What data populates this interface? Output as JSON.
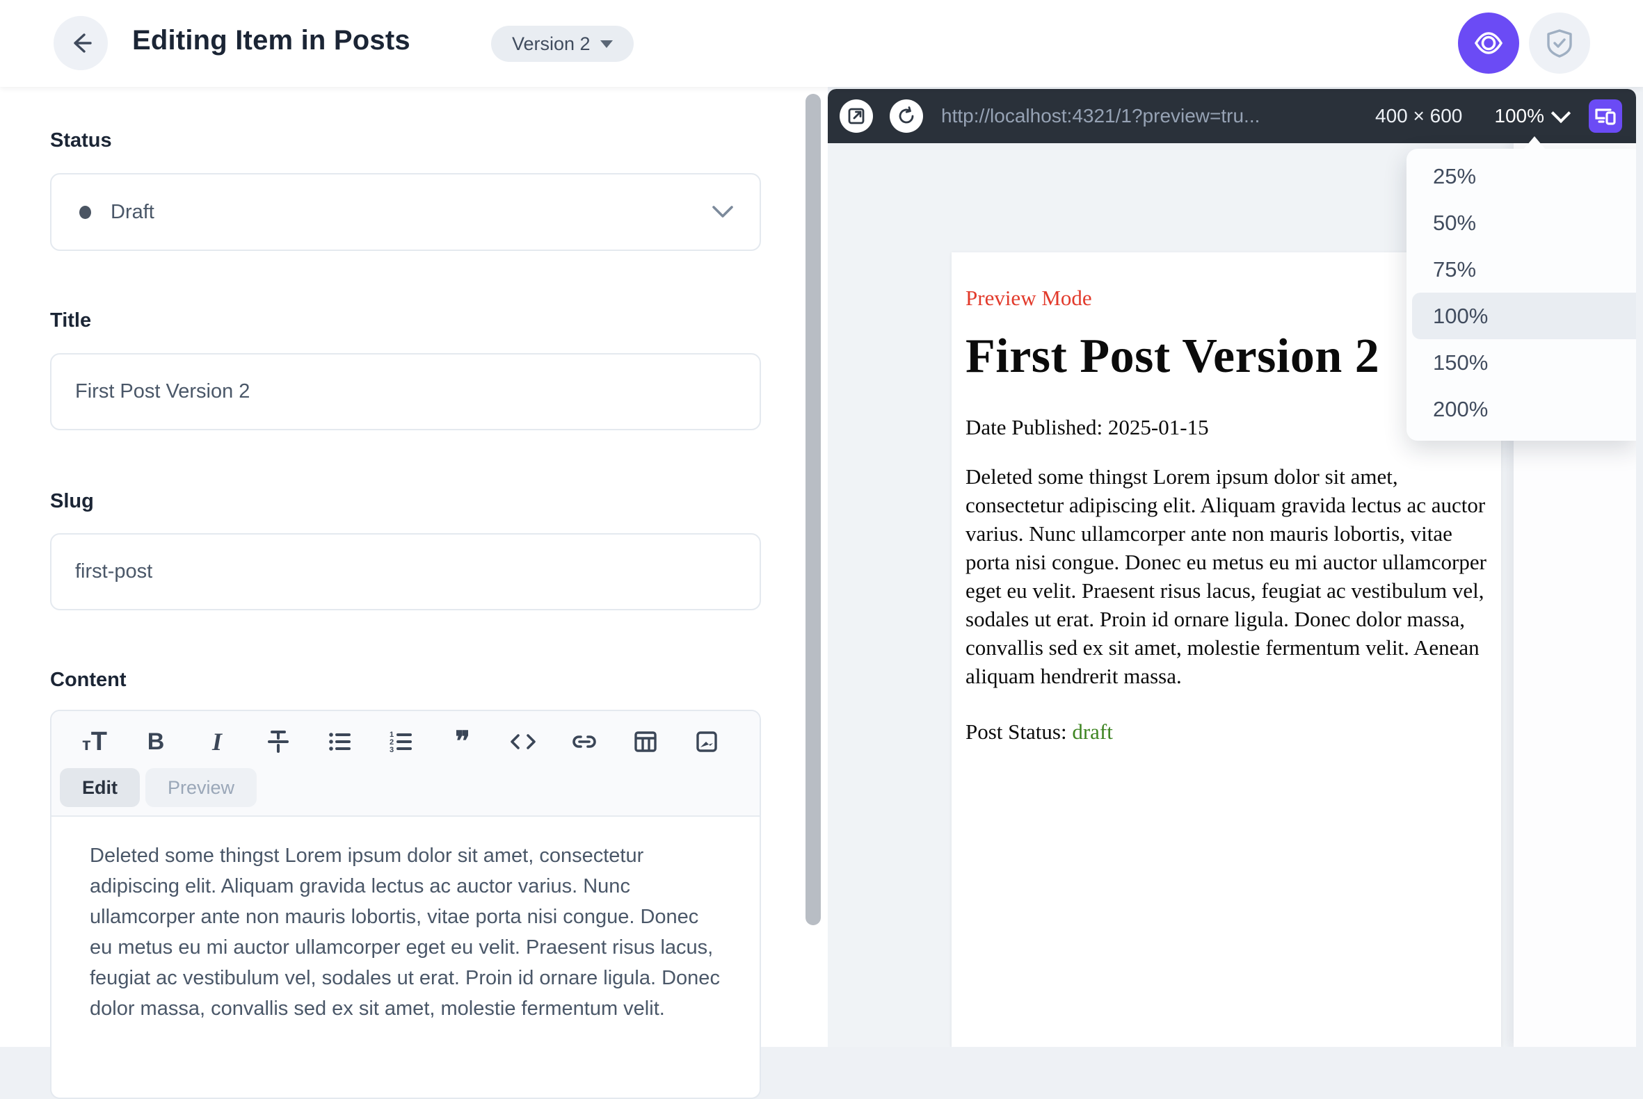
{
  "header": {
    "title": "Editing Item in Posts",
    "version_label": "Version 2"
  },
  "form": {
    "status": {
      "label": "Status",
      "value": "Draft"
    },
    "title": {
      "label": "Title",
      "value": "First Post Version 2"
    },
    "slug": {
      "label": "Slug",
      "value": "first-post"
    },
    "content": {
      "label": "Content",
      "tabs": {
        "edit": "Edit",
        "preview": "Preview"
      },
      "toolbar_icons": [
        "heading",
        "bold",
        "italic",
        "strikethrough",
        "bullet-list",
        "ordered-list",
        "blockquote",
        "code",
        "link",
        "table",
        "image"
      ],
      "value": "Deleted some thingst Lorem ipsum dolor sit amet, consectetur adipiscing elit. Aliquam gravida lectus ac auctor varius. Nunc ullamcorper ante non mauris lobortis, vitae porta nisi congue. Donec eu metus eu mi auctor ullamcorper eget eu velit. Praesent risus lacus, feugiat ac vestibulum vel, sodales ut erat. Proin id ornare ligula. Donec dolor massa, convallis sed ex sit amet, molestie fermentum velit."
    }
  },
  "preview": {
    "url": "http://localhost:4321/1?preview=tru...",
    "viewport_size": "400 × 600",
    "zoom_value": "100%",
    "zoom_menu": {
      "items": [
        "25%",
        "50%",
        "75%",
        "100%",
        "150%",
        "200%"
      ],
      "selected": "100%"
    },
    "page": {
      "badge": "Preview Mode",
      "heading": "First Post Version 2",
      "date_line": "Date Published: 2025-01-15",
      "body": "Deleted some thingst Lorem ipsum dolor sit amet, consectetur adipiscing elit. Aliquam gravida lectus ac auctor varius. Nunc ullamcorper ante non mauris lobortis, vitae porta nisi congue. Donec eu metus eu mi auctor ullamcorper eget eu velit. Praesent risus lacus, feugiat ac vestibulum vel, sodales ut erat. Proin id ornare ligula. Donec dolor massa, convallis sed ex sit amet, molestie fermentum velit. Aenean aliquam hendrerit massa.",
      "status_label": "Post Status: ",
      "status_value": "draft"
    }
  },
  "colors": {
    "accent_purple": "#6b4bf5",
    "bar_dark": "#2a313a",
    "badge_red": "#e23a2b",
    "status_green": "#3e8522",
    "text_dark": "#1b2535"
  }
}
